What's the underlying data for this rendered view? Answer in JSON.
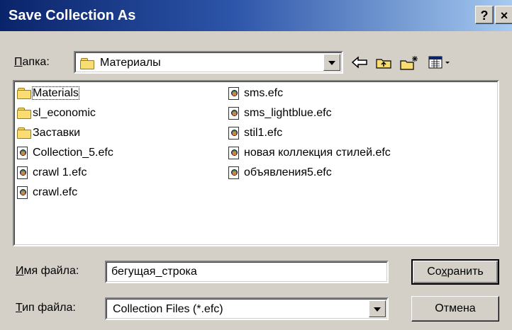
{
  "window": {
    "title": "Save Collection As",
    "help_label": "?",
    "close_label": "×"
  },
  "folder": {
    "label_accel": "П",
    "label_rest": "апка:",
    "current": "Материалы"
  },
  "toolbar": {
    "back_icon": "back-arrow-icon",
    "up_icon": "up-folder-icon",
    "new_folder_icon": "new-folder-icon",
    "view_icon": "view-menu-icon"
  },
  "files": {
    "column1": [
      {
        "name": "Materials",
        "icon": "folder-icon",
        "focused": true
      },
      {
        "name": "sl_economic",
        "icon": "folder-icon"
      },
      {
        "name": "Заставки",
        "icon": "folder-icon"
      },
      {
        "name": "Collection_5.efc",
        "icon": "efc-file-icon"
      },
      {
        "name": "crawl 1.efc",
        "icon": "efc-file-icon"
      },
      {
        "name": "crawl.efc",
        "icon": "efc-file-icon"
      }
    ],
    "column2": [
      {
        "name": "sms.efc",
        "icon": "efc-file-icon"
      },
      {
        "name": "sms_lightblue.efc",
        "icon": "efc-file-icon"
      },
      {
        "name": "stil1.efc",
        "icon": "efc-file-icon"
      },
      {
        "name": "новая коллекция стилей.efc",
        "icon": "efc-file-icon"
      },
      {
        "name": "объявления5.efc",
        "icon": "efc-file-icon"
      }
    ]
  },
  "filename": {
    "label_accel": "И",
    "label_rest": "мя файла:",
    "value": "бегущая_строка"
  },
  "filetype": {
    "label_accel": "Т",
    "label_rest": "ип файла:",
    "value": "Collection Files (*.efc)"
  },
  "buttons": {
    "save_pre": "Со",
    "save_accel": "х",
    "save_post": "ранить",
    "cancel": "Отмена"
  }
}
